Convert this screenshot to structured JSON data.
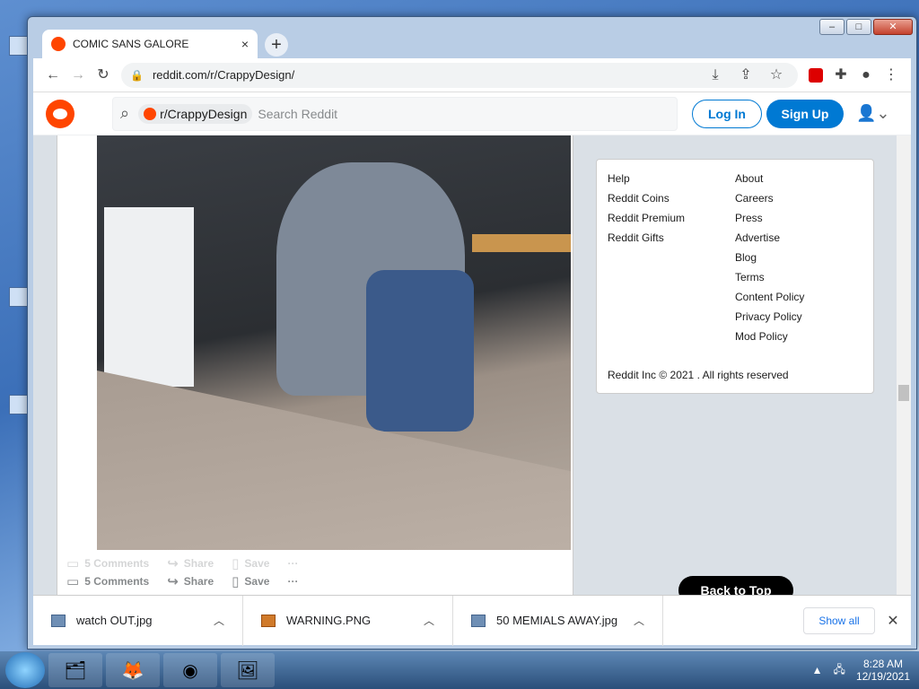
{
  "browser": {
    "tab_title": "COMIC SANS GALORE",
    "url": "reddit.com/r/CrappyDesign/",
    "new_tab_symbol": "+",
    "close_tab_symbol": "×"
  },
  "reddit": {
    "community_chip": "r/CrappyDesign",
    "search_placeholder": "Search Reddit",
    "login": "Log In",
    "signup": "Sign Up"
  },
  "post": {
    "comments": "5 Comments",
    "share": "Share",
    "save": "Save",
    "more": "···"
  },
  "sidebar": {
    "col1": [
      "Help",
      "Reddit Coins",
      "Reddit Premium",
      "Reddit Gifts"
    ],
    "col2": [
      "About",
      "Careers",
      "Press",
      "Advertise",
      "Blog",
      "Terms",
      "Content Policy",
      "Privacy Policy",
      "Mod Policy"
    ],
    "copyright": "Reddit Inc © 2021 . All rights reserved"
  },
  "back_to_top": "Back to Top",
  "downloads": {
    "items": [
      "watch OUT.jpg",
      "WARNING.PNG",
      "50 MEMIALS AWAY.jpg"
    ],
    "show_all": "Show all"
  },
  "taskbar": {
    "time": "8:28 AM",
    "date": "12/19/2021"
  },
  "colors": {
    "reddit_orange": "#ff4500",
    "reddit_blue": "#0079d3"
  }
}
